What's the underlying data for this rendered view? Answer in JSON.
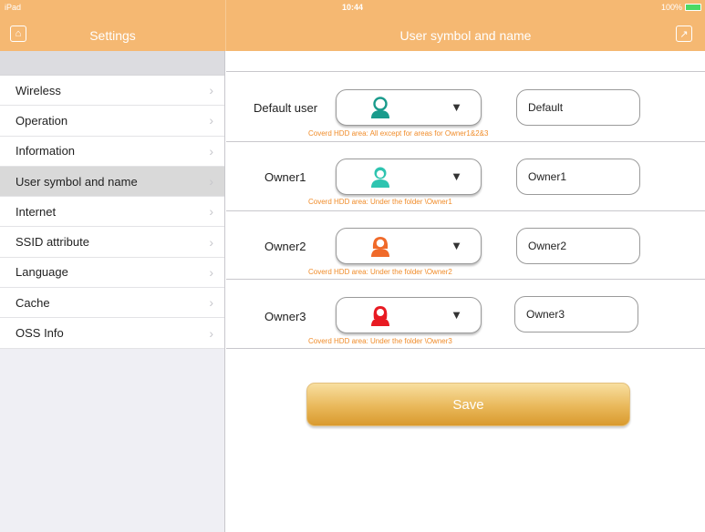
{
  "status_bar": {
    "device": "iPad",
    "time": "10:44",
    "battery": "100%"
  },
  "nav": {
    "left_title": "Settings",
    "right_title": "User symbol and name"
  },
  "sidebar": {
    "items": [
      {
        "label": "Wireless"
      },
      {
        "label": "Operation"
      },
      {
        "label": "Information"
      },
      {
        "label": "User symbol and name",
        "selected": true
      },
      {
        "label": "Internet"
      },
      {
        "label": "SSID attribute"
      },
      {
        "label": "Language"
      },
      {
        "label": "Cache"
      },
      {
        "label": "OSS Info"
      }
    ]
  },
  "users": [
    {
      "label": "Default user",
      "name": "Default",
      "icon": "default-user-icon",
      "icon_color": "#1a9b8c",
      "hint": "Coverd HDD area: All except for areas for Owner1&2&3"
    },
    {
      "label": "Owner1",
      "name": "Owner1",
      "icon": "owner1-user-icon",
      "icon_color": "#2ec4b0",
      "hint": "Coverd HDD area: Under the folder \\Owner1"
    },
    {
      "label": "Owner2",
      "name": "Owner2",
      "icon": "owner2-user-icon",
      "icon_color": "#f06a2a",
      "hint": "Coverd HDD area: Under the folder \\Owner2"
    },
    {
      "label": "Owner3",
      "name": "Owner3",
      "icon": "owner3-user-icon",
      "icon_color": "#e81b23",
      "hint": "Coverd HDD area: Under the folder \\Owner3"
    }
  ],
  "save_label": "Save",
  "colors": {
    "nav_bar": "#f5b872",
    "hint_text": "#f08c2a",
    "save_button": "#e9b85a"
  }
}
